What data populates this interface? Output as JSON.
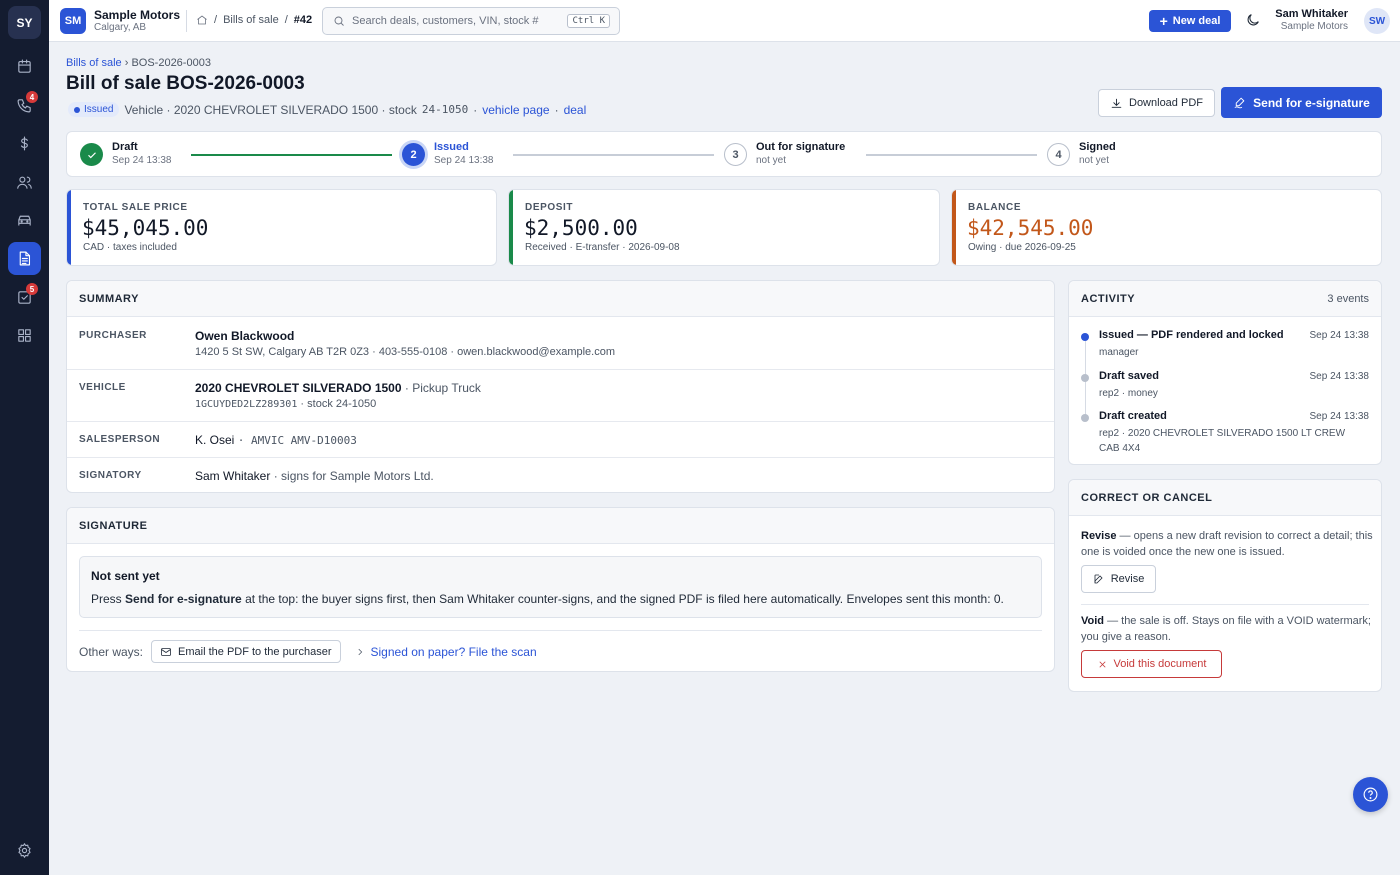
{
  "sidebar": {
    "logo": "SY",
    "items": [
      {
        "icon": "calendar-icon",
        "badge": ""
      },
      {
        "icon": "phone-icon",
        "badge": "4"
      },
      {
        "icon": "dollar-icon",
        "badge": ""
      },
      {
        "icon": "users-icon",
        "badge": ""
      },
      {
        "icon": "car-icon",
        "badge": ""
      },
      {
        "icon": "document-icon",
        "badge": "",
        "active": true
      },
      {
        "icon": "checklist-icon",
        "badge": "5"
      },
      {
        "icon": "grid-icon",
        "badge": ""
      }
    ],
    "footer_icon": "settings-icon"
  },
  "topbar": {
    "org_initials": "SM",
    "org_name": "Sample Motors",
    "org_location": "Calgary, AB",
    "crumb_sep": "/",
    "crumb_section": "Bills of sale",
    "crumb_current": "#42",
    "search_placeholder": "Search deals, customers, VIN, stock #",
    "search_shortcut": "Ctrl K",
    "new_deal_label": "New deal",
    "user_name": "Sam Whitaker",
    "user_org": "Sample Motors",
    "user_initials": "SW"
  },
  "header": {
    "breadcrumb_parent": "Bills of sale",
    "breadcrumb_sep": "›",
    "breadcrumb_current": "BOS-2026-0003",
    "title": "Bill of sale BOS-2026-0003",
    "status": "Issued",
    "meta_text": "Vehicle · 2020 CHEVROLET SILVERADO 1500 · stock",
    "meta_stock": "24-1050",
    "meta_sep": "·",
    "link_vehicle": "vehicle page",
    "link_deal": "deal",
    "download_label": "Download PDF",
    "esign_label": "Send for e-signature"
  },
  "stepper": [
    {
      "label": "Draft",
      "sub": "Sep 24 13:38",
      "state": "done",
      "num": ""
    },
    {
      "label": "Issued",
      "sub": "Sep 24 13:38",
      "state": "current",
      "num": "2"
    },
    {
      "label": "Out for signature",
      "sub": "not yet",
      "state": "todo",
      "num": "3"
    },
    {
      "label": "Signed",
      "sub": "not yet",
      "state": "todo",
      "num": "4"
    }
  ],
  "totals": {
    "total": {
      "label": "TOTAL SALE PRICE",
      "amount": "$45,045.00",
      "sub": "CAD · taxes included",
      "color": "#2b54d6"
    },
    "deposit": {
      "label": "DEPOSIT",
      "amount": "$2,500.00",
      "sub": "Received · E-transfer · 2026-09-08",
      "color": "#1a8a4a"
    },
    "balance": {
      "label": "BALANCE",
      "amount": "$42,545.00",
      "sub": "Owing · due 2026-09-25",
      "color": "#c2571a"
    }
  },
  "summary": {
    "title": "SUMMARY",
    "purchaser_key": "PURCHASER",
    "purchaser_name": "Owen Blackwood",
    "purchaser_detail": "1420 5 St SW, Calgary AB T2R 0Z3 · 403-555-0108 · owen.blackwood@example.com",
    "vehicle_key": "VEHICLE",
    "vehicle_name": "2020 CHEVROLET SILVERADO 1500",
    "vehicle_type": "· Pickup Truck",
    "vehicle_vin": "1GCUYDED2LZ289301",
    "vehicle_stock": "· stock 24-1050",
    "salesperson_key": "SALESPERSON",
    "salesperson_name": "K. Osei",
    "salesperson_license": "· AMVIC AMV-D10003",
    "signatory_key": "SIGNATORY",
    "signatory_name": "Sam Whitaker",
    "signatory_detail": "· signs for Sample Motors Ltd."
  },
  "signature": {
    "title": "SIGNATURE",
    "notice_title": "Not sent yet",
    "notice_pre": "Press",
    "notice_strong": "Send for e-signature",
    "notice_post": "at the top: the buyer signs first, then Sam Whitaker counter-signs, and the signed PDF is filed here automatically. Envelopes sent this month: 0.",
    "other_label": "Other ways:",
    "email_label": "Email the PDF to the purchaser",
    "scan_label": "Signed on paper? File the scan"
  },
  "activity": {
    "title": "ACTIVITY",
    "count": "3 events",
    "events": [
      {
        "title": "Issued — PDF rendered and locked",
        "time": "Sep 24 13:38",
        "sub": "manager"
      },
      {
        "title": "Draft saved",
        "time": "Sep 24 13:38",
        "sub": "rep2 · money"
      },
      {
        "title": "Draft created",
        "time": "Sep 24 13:38",
        "sub": "rep2 · 2020 CHEVROLET SILVERADO 1500 LT CREW CAB 4X4"
      }
    ]
  },
  "correct": {
    "title": "CORRECT OR CANCEL",
    "revise_strong": "Revise",
    "revise_text": "— opens a new draft revision to correct a detail; this one is voided once the new one is issued.",
    "revise_label": "Revise",
    "void_strong": "Void",
    "void_text": "— the sale is off. Stays on file with a VOID watermark; you give a reason.",
    "void_label": "Void this document"
  },
  "help_icon": "help-icon"
}
